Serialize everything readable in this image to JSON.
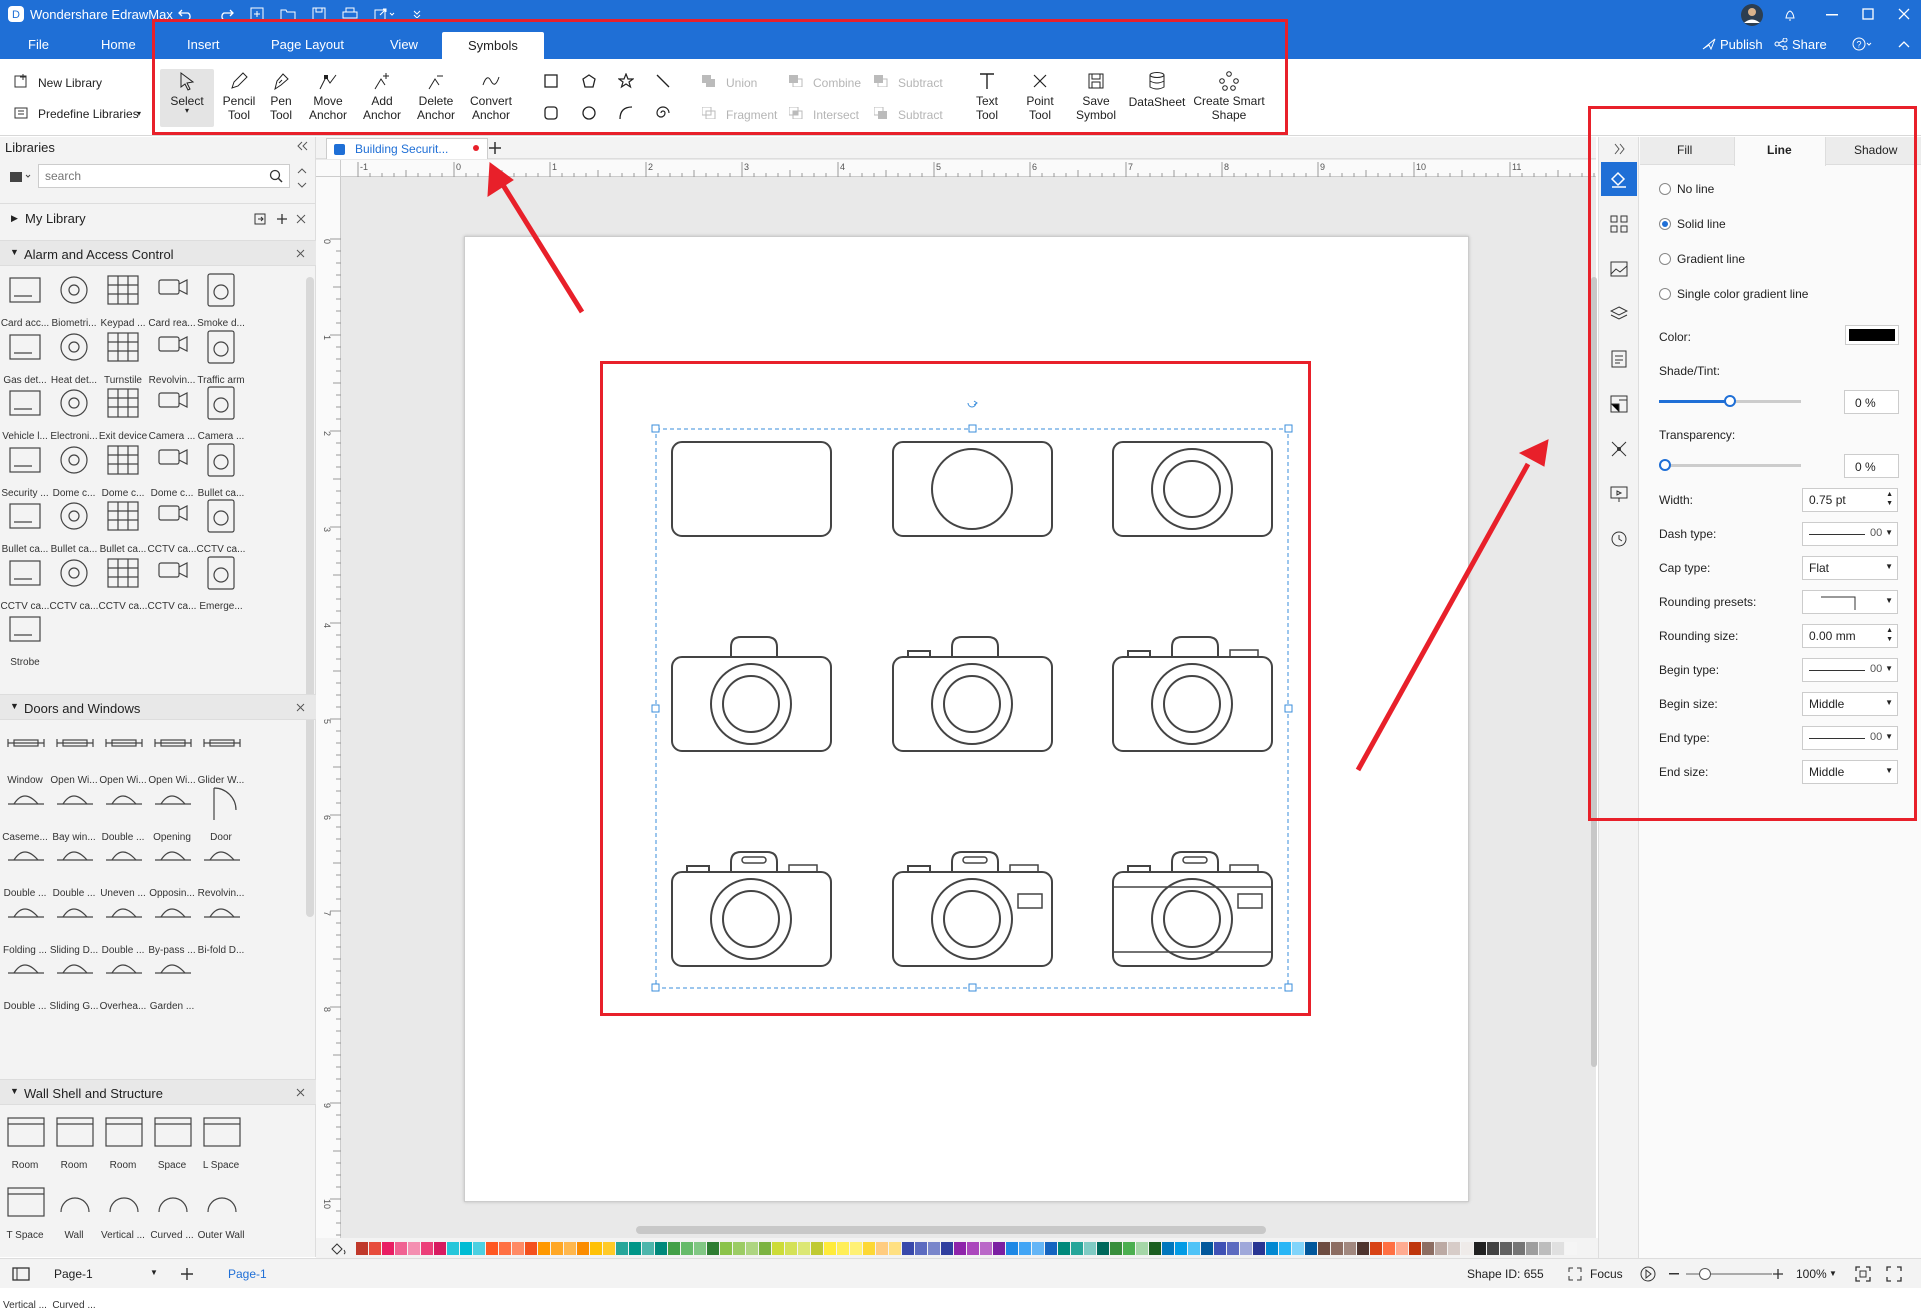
{
  "app": {
    "title": "Wondershare EdrawMax"
  },
  "menu": {
    "file": "File",
    "home": "Home",
    "insert": "Insert",
    "page_layout": "Page Layout",
    "view": "View",
    "symbols": "Symbols"
  },
  "header": {
    "publish": "Publish",
    "share": "Share"
  },
  "ribbon": {
    "new_library": "New Library",
    "predefine_libraries": "Predefine Libraries",
    "select": "Select",
    "pencil_tool": [
      "Pencil",
      "Tool"
    ],
    "pen_tool": [
      "Pen",
      "Tool"
    ],
    "move_anchor": [
      "Move",
      "Anchor"
    ],
    "add_anchor": [
      "Add",
      "Anchor"
    ],
    "delete_anchor": [
      "Delete",
      "Anchor"
    ],
    "convert_anchor": [
      "Convert",
      "Anchor"
    ],
    "union": "Union",
    "combine": "Combine",
    "subtract": "Subtract",
    "fragment": "Fragment",
    "intersect": "Intersect",
    "subtract2": "Subtract",
    "text_tool": [
      "Text",
      "Tool"
    ],
    "point_tool": [
      "Point",
      "Tool"
    ],
    "save_symbol": [
      "Save",
      "Symbol"
    ],
    "datasheet": "DataSheet",
    "create_smart_shape": [
      "Create Smart",
      "Shape"
    ]
  },
  "libraries": {
    "title": "Libraries",
    "search_placeholder": "search",
    "my_library": "My Library",
    "sections": [
      {
        "name": "Alarm and Access Control",
        "items": [
          "Card acc...",
          "Biometri...",
          "Keypad ...",
          "Card rea...",
          "Smoke d...",
          "Gas det...",
          "Heat det...",
          "Turnstile",
          "Revolvin...",
          "Traffic arm",
          "Vehicle l...",
          "Electroni...",
          "Exit device",
          "Camera ...",
          "Camera ...",
          "Security ...",
          "Dome c...",
          "Dome c...",
          "Dome c...",
          "Bullet ca...",
          "Bullet ca...",
          "Bullet ca...",
          "Bullet ca...",
          "CCTV ca...",
          "CCTV ca...",
          "CCTV ca...",
          "CCTV ca...",
          "CCTV ca...",
          "CCTV ca...",
          "Emerge...",
          "Strobe"
        ]
      },
      {
        "name": "Doors and Windows",
        "items": [
          "Window",
          "Open Wi...",
          "Open Wi...",
          "Open Wi...",
          "Glider W...",
          "Caseme...",
          "Bay win...",
          "Double ...",
          "Opening",
          "Door",
          "Double ...",
          "Double ...",
          "Uneven ...",
          "Opposin...",
          "Revolvin...",
          "Folding ...",
          "Sliding D...",
          "Double ...",
          "By-pass ...",
          "Bi-fold D...",
          "Double ...",
          "Sliding G...",
          "Overhea...",
          "Garden ..."
        ]
      },
      {
        "name": "Wall Shell and Structure",
        "items": [
          "Room",
          "Room",
          "Room",
          "Space",
          "L Space",
          "T Space",
          "Wall",
          "Vertical ...",
          "Curved ...",
          "Outer Wall",
          "Vertical ...",
          "Curved ..."
        ]
      }
    ]
  },
  "doc_tab": {
    "name": "Building Securit..."
  },
  "ruler": {
    "top": [
      "-1",
      "0",
      "1",
      "2",
      "3",
      "4",
      "5",
      "6",
      "7",
      "8",
      "9",
      "10",
      "11"
    ],
    "left": [
      "0",
      "1",
      "2",
      "3",
      "4",
      "5",
      "6",
      "7",
      "8",
      "9",
      "10"
    ]
  },
  "right_panel": {
    "tabs": [
      "Fill",
      "Line",
      "Shadow"
    ],
    "radios": [
      "No line",
      "Solid line",
      "Gradient line",
      "Single color gradient line"
    ],
    "selected_radio": "Solid line",
    "color_label": "Color:",
    "color_value": "#000000",
    "shade_label": "Shade/Tint:",
    "shade_value": "0 %",
    "shade_level": 0.5,
    "transparency_label": "Transparency:",
    "transparency_value": "0 %",
    "transparency_level": 0,
    "width_label": "Width:",
    "width_value": "0.75 pt",
    "dash_label": "Dash type:",
    "dash_value": "00",
    "cap_label": "Cap type:",
    "cap_value": "Flat",
    "rounding_presets_label": "Rounding presets:",
    "rounding_size_label": "Rounding size:",
    "rounding_size_value": "0.00 mm",
    "begin_type_label": "Begin type:",
    "begin_type_value": "00",
    "begin_size_label": "Begin size:",
    "begin_size_value": "Middle",
    "end_type_label": "End type:",
    "end_type_value": "00",
    "end_size_label": "End size:",
    "end_size_value": "Middle"
  },
  "status": {
    "page_select": "Page-1",
    "page_tab": "Page-1",
    "shape_id": "Shape ID: 655",
    "focus": "Focus",
    "zoom": "100%"
  },
  "colors": {
    "accent": "#1f6fd6",
    "highlight": "#e8202a"
  },
  "palette": [
    "#c0392b",
    "#e74c3c",
    "#e91e63",
    "#f06292",
    "#f48fb1",
    "#ec407a",
    "#d81b60",
    "#26c6da",
    "#00bcd4",
    "#4dd0e1",
    "#ff5722",
    "#ff7043",
    "#ff8a65",
    "#f4511e",
    "#ff9800",
    "#ffa726",
    "#ffb74d",
    "#fb8c00",
    "#ffc107",
    "#ffca28",
    "#26a69a",
    "#009688",
    "#4db6ac",
    "#00897b",
    "#43a047",
    "#66bb6a",
    "#81c784",
    "#2e7d32",
    "#8bc34a",
    "#9ccc65",
    "#aed581",
    "#7cb342",
    "#cddc39",
    "#d4e157",
    "#dce775",
    "#c0ca33",
    "#ffeb3b",
    "#ffee58",
    "#fff176",
    "#fdd835",
    "#ffcc80",
    "#ffe082",
    "#3949ab",
    "#5c6bc0",
    "#7986cb",
    "#303f9f",
    "#8e24aa",
    "#ab47bc",
    "#ba68c8",
    "#7b1fa2",
    "#1e88e5",
    "#42a5f5",
    "#64b5f6",
    "#1565c0",
    "#00897b",
    "#26a69a",
    "#80cbc4",
    "#00695c",
    "#388e3c",
    "#4caf50",
    "#a5d6a7",
    "#1b5e20",
    "#0277bd",
    "#039be5",
    "#4fc3f7",
    "#01579b",
    "#3f51b5",
    "#5c6bc0",
    "#9fa8da",
    "#283593",
    "#0288d1",
    "#29b6f6",
    "#81d4fa",
    "#01579b",
    "#6d4c41",
    "#8d6e63",
    "#a1887f",
    "#4e342e",
    "#d84315",
    "#ff7043",
    "#ffab91",
    "#bf360c",
    "#8d6e63",
    "#bcaaa4",
    "#d7ccc8",
    "#efebe9",
    "#212121",
    "#424242",
    "#616161",
    "#757575",
    "#9e9e9e",
    "#bdbdbd",
    "#e0e0e0",
    "#f5f5f5"
  ]
}
